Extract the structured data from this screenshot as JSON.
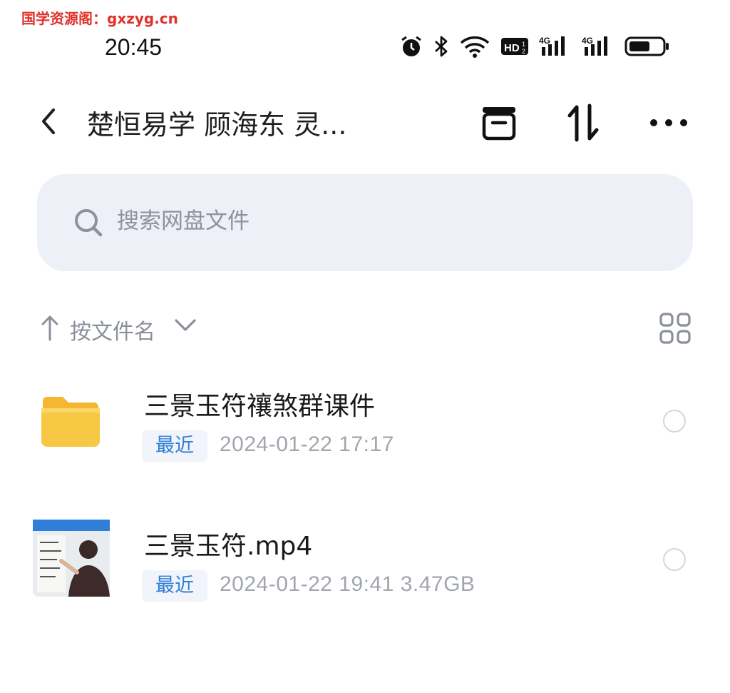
{
  "watermark": "国学资源阁：gxzyg.cn",
  "status": {
    "time": "20:45",
    "icons": [
      "alarm-icon",
      "bluetooth-icon",
      "wifi-icon",
      "hd-icon",
      "signal-4g-icon",
      "signal-4g-icon",
      "battery-icon"
    ]
  },
  "header": {
    "title": "楚恒易学 顾海东 灵...",
    "icons": [
      "back-icon",
      "archive-icon",
      "sort-toggle-icon",
      "more-icon"
    ]
  },
  "search": {
    "placeholder": "搜索网盘文件"
  },
  "sort": {
    "label": "按文件名"
  },
  "files": [
    {
      "name": "三景玉符禳煞群课件",
      "badge": "最近",
      "meta": "2024-01-22  17:17",
      "type": "folder"
    },
    {
      "name": "三景玉符.mp4",
      "badge": "最近",
      "meta": "2024-01-22  19:41   3.47GB",
      "type": "video"
    }
  ],
  "colors": {
    "accent": "#2f7fd8",
    "folder": "#f7c843",
    "search_bg": "#eef0f7",
    "watermark": "#e0322b"
  }
}
